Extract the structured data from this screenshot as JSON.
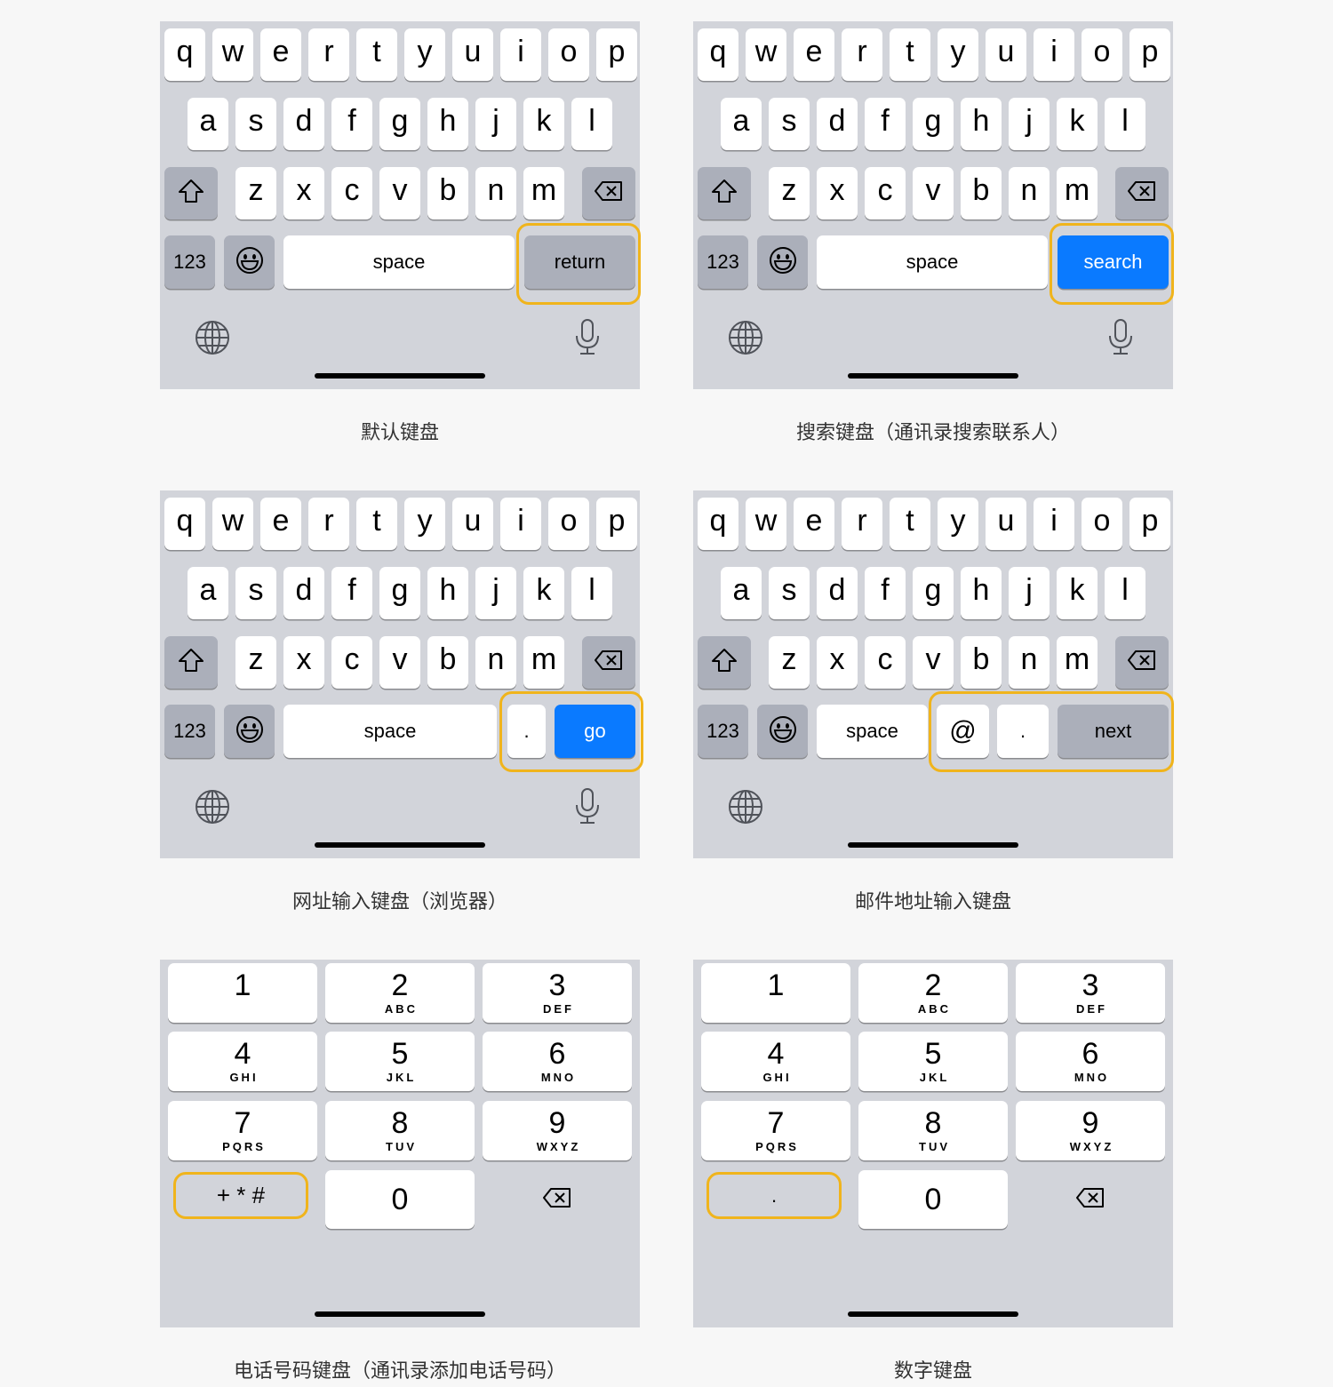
{
  "colors": {
    "keyboard_bg": "#d2d4da",
    "function_key": "#abafba",
    "accent_blue": "#0a7aff",
    "highlight": "#f0b41c"
  },
  "letter_rows": [
    [
      "q",
      "w",
      "e",
      "r",
      "t",
      "y",
      "u",
      "i",
      "o",
      "p"
    ],
    [
      "a",
      "s",
      "d",
      "f",
      "g",
      "h",
      "j",
      "k",
      "l"
    ],
    [
      "z",
      "x",
      "c",
      "v",
      "b",
      "n",
      "m"
    ]
  ],
  "common": {
    "numbers_key": "123",
    "space": "space"
  },
  "keyboards": [
    {
      "type": "default",
      "caption": "默认键盘",
      "action": "return",
      "icons": [
        "shift-icon",
        "delete-icon",
        "emoji-icon",
        "globe-icon",
        "microphone-icon"
      ]
    },
    {
      "type": "search",
      "caption": "搜索键盘（通讯录搜索联系人）",
      "action": "search",
      "icons": [
        "shift-icon",
        "delete-icon",
        "emoji-icon",
        "globe-icon",
        "microphone-icon"
      ]
    },
    {
      "type": "url",
      "caption": "网址输入键盘（浏览器）",
      "dot": ".",
      "action": "go",
      "icons": [
        "shift-icon",
        "delete-icon",
        "emoji-icon",
        "globe-icon",
        "microphone-icon"
      ]
    },
    {
      "type": "email",
      "caption": "邮件地址输入键盘",
      "at": "@",
      "dot": ".",
      "action": "next",
      "icons": [
        "shift-icon",
        "delete-icon",
        "emoji-icon",
        "globe-icon"
      ]
    },
    {
      "type": "phone",
      "caption": "电话号码键盘（通讯录添加电话号码）",
      "special": "+ * #",
      "zero": "0"
    },
    {
      "type": "decimal",
      "caption": "数字键盘",
      "special": ".",
      "zero": "0"
    }
  ],
  "numpad": [
    {
      "digit": "1",
      "letters": ""
    },
    {
      "digit": "2",
      "letters": "ABC"
    },
    {
      "digit": "3",
      "letters": "DEF"
    },
    {
      "digit": "4",
      "letters": "GHI"
    },
    {
      "digit": "5",
      "letters": "JKL"
    },
    {
      "digit": "6",
      "letters": "MNO"
    },
    {
      "digit": "7",
      "letters": "PQRS"
    },
    {
      "digit": "8",
      "letters": "TUV"
    },
    {
      "digit": "9",
      "letters": "WXYZ"
    }
  ]
}
